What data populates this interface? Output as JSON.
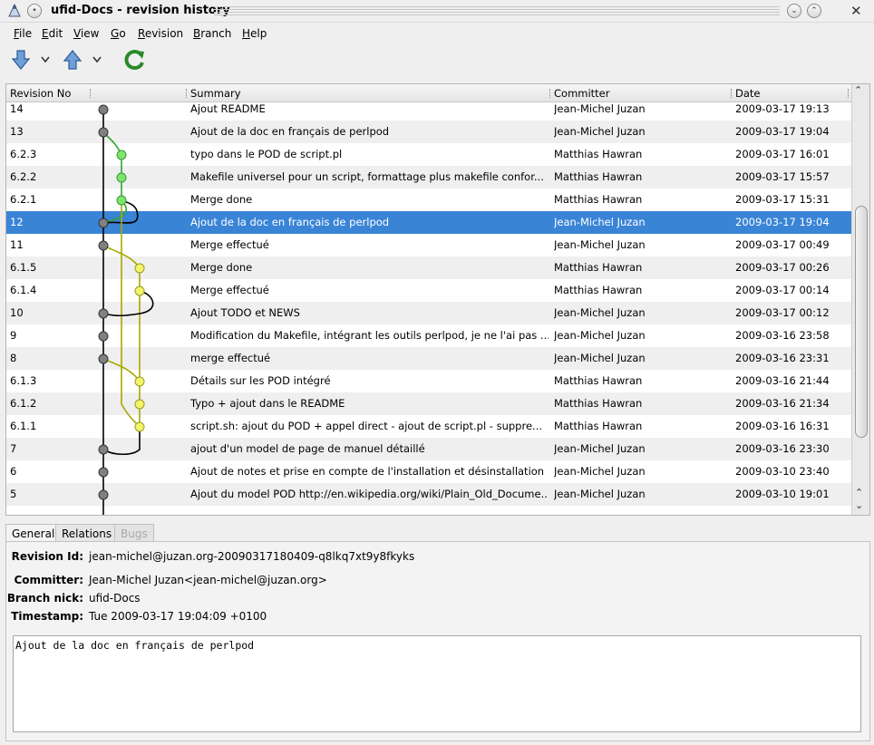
{
  "window": {
    "title": "ufid-Docs - revision history"
  },
  "menu": [
    {
      "key": "F",
      "rest": "ile"
    },
    {
      "key": "E",
      "rest": "dit"
    },
    {
      "key": "V",
      "rest": "iew"
    },
    {
      "key": "G",
      "rest": "o"
    },
    {
      "key": "R",
      "rest": "evision"
    },
    {
      "key": "B",
      "rest": "ranch"
    },
    {
      "key": "H",
      "rest": "elp"
    }
  ],
  "table": {
    "columns": [
      "Revision No",
      "Summary",
      "Committer",
      "Date"
    ],
    "rows": [
      {
        "rev": "14",
        "summary": "Ajout README",
        "committer": "Jean-Michel Juzan",
        "date": "2009-03-17 19:13"
      },
      {
        "rev": "13",
        "summary": "Ajout de la doc en français de perlpod",
        "committer": "Jean-Michel Juzan",
        "date": "2009-03-17 19:04"
      },
      {
        "rev": "6.2.3",
        "summary": "typo dans le POD de script.pl",
        "committer": "Matthias Hawran",
        "date": "2009-03-17 16:01"
      },
      {
        "rev": "6.2.2",
        "summary": "Makefile universel pour un script, formattage plus makefile confor...",
        "committer": "Matthias Hawran",
        "date": "2009-03-17 15:57"
      },
      {
        "rev": "6.2.1",
        "summary": "Merge done",
        "committer": "Matthias Hawran",
        "date": "2009-03-17 15:31"
      },
      {
        "rev": "12",
        "summary": "Ajout de la doc en français de perlpod",
        "committer": "Jean-Michel Juzan",
        "date": "2009-03-17 19:04"
      },
      {
        "rev": "11",
        "summary": "Merge effectué",
        "committer": "Jean-Michel Juzan",
        "date": "2009-03-17 00:49"
      },
      {
        "rev": "6.1.5",
        "summary": "Merge done",
        "committer": "Matthias Hawran",
        "date": "2009-03-17 00:26"
      },
      {
        "rev": "6.1.4",
        "summary": "Merge effectué",
        "committer": "Matthias Hawran",
        "date": "2009-03-17 00:14"
      },
      {
        "rev": "10",
        "summary": "Ajout TODO et NEWS",
        "committer": "Jean-Michel Juzan",
        "date": "2009-03-17 00:12"
      },
      {
        "rev": "9",
        "summary": "Modification du Makefile, intégrant les outils perlpod, je ne l'ai pas ...",
        "committer": "Jean-Michel Juzan",
        "date": "2009-03-16 23:58"
      },
      {
        "rev": "8",
        "summary": "merge effectué",
        "committer": "Jean-Michel Juzan",
        "date": "2009-03-16 23:31"
      },
      {
        "rev": "6.1.3",
        "summary": "Détails sur les POD intégré",
        "committer": "Matthias Hawran",
        "date": "2009-03-16 21:44"
      },
      {
        "rev": "6.1.2",
        "summary": "Typo + ajout dans le README",
        "committer": "Matthias Hawran",
        "date": "2009-03-16 21:34"
      },
      {
        "rev": "6.1.1",
        "summary": "script.sh: ajout du POD + appel direct - ajout de script.pl - suppre...",
        "committer": "Matthias Hawran",
        "date": "2009-03-16 16:31"
      },
      {
        "rev": "7",
        "summary": "ajout d'un model de page de manuel détaillé",
        "committer": "Jean-Michel Juzan",
        "date": "2009-03-16 23:30"
      },
      {
        "rev": "6",
        "summary": "Ajout de notes et prise en compte de l'installation et désinstallation",
        "committer": "Jean-Michel Juzan",
        "date": "2009-03-10 23:40"
      },
      {
        "rev": "5",
        "summary": "Ajout du model POD http://en.wikipedia.org/wiki/Plain_Old_Docume...",
        "committer": "Jean-Michel Juzan",
        "date": "2009-03-10 19:01"
      }
    ],
    "selected_index": 5
  },
  "tabs": [
    "General",
    "Relations",
    "Bugs"
  ],
  "details": {
    "revision_id_label": "Revision Id:",
    "revision_id": "jean-michel@juzan.org-20090317180409-q8lkq7xt9y8fkyks",
    "committer_label": "Committer:",
    "committer": "Jean-Michel Juzan<jean-michel@juzan.org>",
    "branch_nick_label": "Branch nick:",
    "branch_nick": "ufid-Docs",
    "timestamp_label": "Timestamp:",
    "timestamp": "Tue 2009-03-17 19:04:09 +0100",
    "message": "Ajout de la doc en français de perlpod"
  },
  "colors": {
    "selection": "#3a84d6",
    "branch_green": "#7de56a",
    "branch_yellow": "#f4f46c",
    "node_grey": "#808080"
  }
}
